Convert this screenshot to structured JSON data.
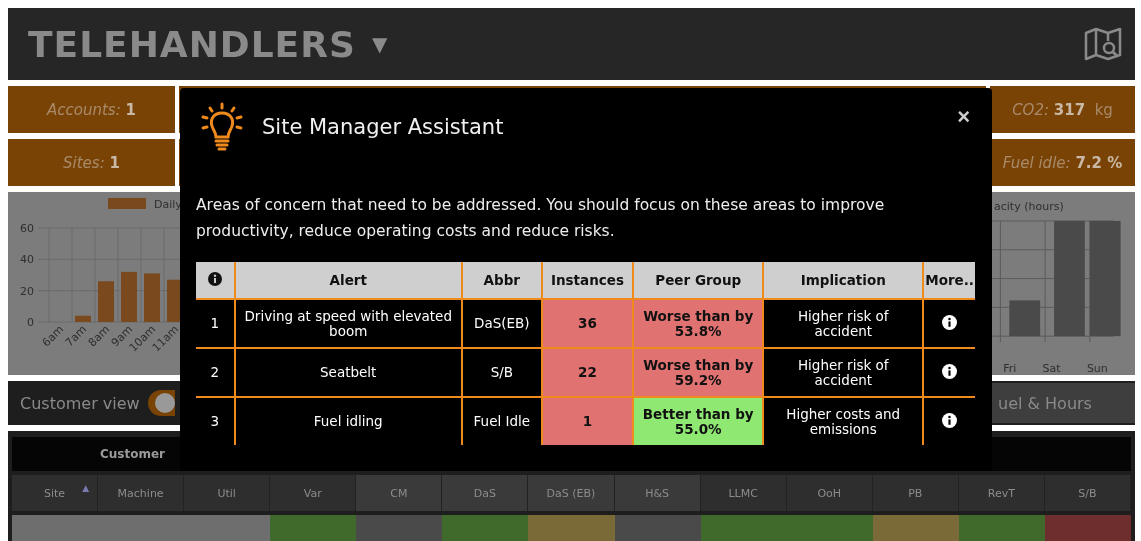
{
  "header": {
    "title": "TELEHANDLERS",
    "dropdown_caret": "▼"
  },
  "stat_rows": [
    {
      "left": {
        "label": "Accounts:",
        "value": "1"
      },
      "right": {
        "label": "CO2:",
        "value": "317",
        "unit": "kg"
      }
    },
    {
      "left": {
        "label": "Sites:",
        "value": "1"
      },
      "right": {
        "label": "Fuel idle:",
        "value": "7.2 %"
      }
    }
  ],
  "left_chart": {
    "chart_data": {
      "type": "bar",
      "categories": [
        "6am",
        "7am",
        "8am",
        "9am",
        "10am",
        "11am"
      ],
      "series": [
        {
          "name": "Daily",
          "color": "#7a4a1e",
          "values": [
            0,
            4,
            26,
            32,
            31,
            27
          ]
        }
      ],
      "ylim": [
        0,
        60
      ],
      "yticks": [
        0,
        20,
        40,
        60
      ]
    }
  },
  "right_chart": {
    "legend": "acity (hours)",
    "categories": [
      "Fri",
      "Sat",
      "Sun"
    ]
  },
  "customer_view": {
    "label": "Customer view",
    "on": true
  },
  "fuel_hours_button": "uel & Hours",
  "customer_table": {
    "title": "Customer",
    "columns": [
      {
        "label": "Site",
        "sort_indicator": "▲"
      },
      {
        "label": "Machine"
      },
      {
        "label": "Util"
      },
      {
        "label": "Var"
      },
      {
        "label": "CM"
      },
      {
        "label": "DaS"
      },
      {
        "label": "DaS (EB)"
      },
      {
        "label": "H&S"
      },
      {
        "label": "LLMC"
      },
      {
        "label": "OoH"
      },
      {
        "label": "PB"
      },
      {
        "label": "RevT"
      },
      {
        "label": "S/B"
      }
    ],
    "first_row_cells": [
      {
        "color": "#6e6e6e"
      },
      {
        "color": "#6e6e6e"
      },
      {
        "color": "#6e6e6e"
      },
      {
        "color": "#3f6a2c"
      },
      {
        "color": "#4a4a4a"
      },
      {
        "color": "#3f6a2c"
      },
      {
        "color": "#7a6a38"
      },
      {
        "color": "#4a4a4a"
      },
      {
        "color": "#3f6a2c"
      },
      {
        "color": "#3f6a2c"
      },
      {
        "color": "#7a6a38"
      },
      {
        "color": "#3f6a2c"
      },
      {
        "color": "#6e2e2e"
      }
    ]
  },
  "modal": {
    "title": "Site Manager Assistant",
    "close": "×",
    "intro": "Areas of concern that need to be addressed. You should focus on these areas to improve productivity, reduce operating costs and reduce risks.",
    "columns": [
      "Alert",
      "Abbr",
      "Instances",
      "Peer Group",
      "Implication",
      "More.."
    ],
    "rows": [
      {
        "index": "1",
        "alert": "Driving at speed with elevated boom",
        "abbr": "DaS(EB)",
        "instances": {
          "text": "36",
          "color": "#e07272"
        },
        "peer_group": {
          "text": "Worse than by 53.8%",
          "color": "#e07272"
        },
        "implication": "Higher risk of accident"
      },
      {
        "index": "2",
        "alert": "Seatbelt",
        "abbr": "S/B",
        "instances": {
          "text": "22",
          "color": "#e07272"
        },
        "peer_group": {
          "text": "Worse than by 59.2%",
          "color": "#e07272"
        },
        "implication": "Higher risk of accident"
      },
      {
        "index": "3",
        "alert": "Fuel idling",
        "abbr": "Fuel Idle",
        "instances": {
          "text": "1",
          "color": "#e07272"
        },
        "peer_group": {
          "text": "Better than by 55.0%",
          "color": "#8ee872"
        },
        "implication": "Higher costs and emissions"
      }
    ]
  }
}
